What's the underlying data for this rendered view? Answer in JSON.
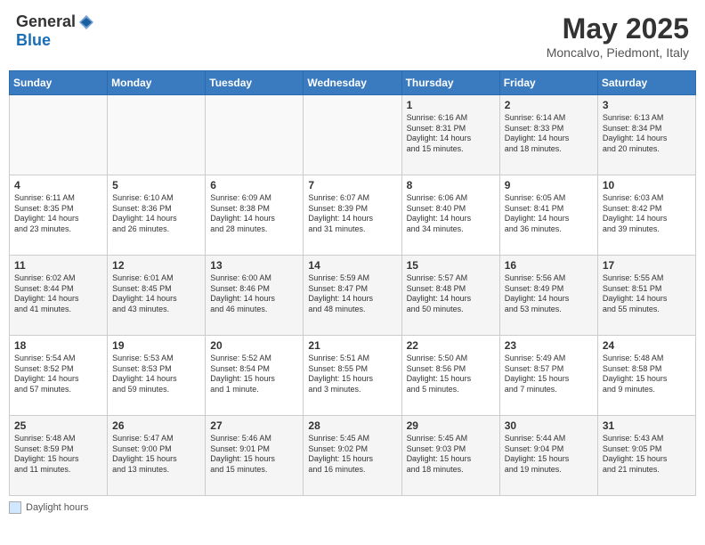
{
  "header": {
    "logo_general": "General",
    "logo_blue": "Blue",
    "month_title": "May 2025",
    "location": "Moncalvo, Piedmont, Italy"
  },
  "days_of_week": [
    "Sunday",
    "Monday",
    "Tuesday",
    "Wednesday",
    "Thursday",
    "Friday",
    "Saturday"
  ],
  "weeks": [
    [
      {
        "day": "",
        "info": ""
      },
      {
        "day": "",
        "info": ""
      },
      {
        "day": "",
        "info": ""
      },
      {
        "day": "",
        "info": ""
      },
      {
        "day": "1",
        "info": "Sunrise: 6:16 AM\nSunset: 8:31 PM\nDaylight: 14 hours\nand 15 minutes."
      },
      {
        "day": "2",
        "info": "Sunrise: 6:14 AM\nSunset: 8:33 PM\nDaylight: 14 hours\nand 18 minutes."
      },
      {
        "day": "3",
        "info": "Sunrise: 6:13 AM\nSunset: 8:34 PM\nDaylight: 14 hours\nand 20 minutes."
      }
    ],
    [
      {
        "day": "4",
        "info": "Sunrise: 6:11 AM\nSunset: 8:35 PM\nDaylight: 14 hours\nand 23 minutes."
      },
      {
        "day": "5",
        "info": "Sunrise: 6:10 AM\nSunset: 8:36 PM\nDaylight: 14 hours\nand 26 minutes."
      },
      {
        "day": "6",
        "info": "Sunrise: 6:09 AM\nSunset: 8:38 PM\nDaylight: 14 hours\nand 28 minutes."
      },
      {
        "day": "7",
        "info": "Sunrise: 6:07 AM\nSunset: 8:39 PM\nDaylight: 14 hours\nand 31 minutes."
      },
      {
        "day": "8",
        "info": "Sunrise: 6:06 AM\nSunset: 8:40 PM\nDaylight: 14 hours\nand 34 minutes."
      },
      {
        "day": "9",
        "info": "Sunrise: 6:05 AM\nSunset: 8:41 PM\nDaylight: 14 hours\nand 36 minutes."
      },
      {
        "day": "10",
        "info": "Sunrise: 6:03 AM\nSunset: 8:42 PM\nDaylight: 14 hours\nand 39 minutes."
      }
    ],
    [
      {
        "day": "11",
        "info": "Sunrise: 6:02 AM\nSunset: 8:44 PM\nDaylight: 14 hours\nand 41 minutes."
      },
      {
        "day": "12",
        "info": "Sunrise: 6:01 AM\nSunset: 8:45 PM\nDaylight: 14 hours\nand 43 minutes."
      },
      {
        "day": "13",
        "info": "Sunrise: 6:00 AM\nSunset: 8:46 PM\nDaylight: 14 hours\nand 46 minutes."
      },
      {
        "day": "14",
        "info": "Sunrise: 5:59 AM\nSunset: 8:47 PM\nDaylight: 14 hours\nand 48 minutes."
      },
      {
        "day": "15",
        "info": "Sunrise: 5:57 AM\nSunset: 8:48 PM\nDaylight: 14 hours\nand 50 minutes."
      },
      {
        "day": "16",
        "info": "Sunrise: 5:56 AM\nSunset: 8:49 PM\nDaylight: 14 hours\nand 53 minutes."
      },
      {
        "day": "17",
        "info": "Sunrise: 5:55 AM\nSunset: 8:51 PM\nDaylight: 14 hours\nand 55 minutes."
      }
    ],
    [
      {
        "day": "18",
        "info": "Sunrise: 5:54 AM\nSunset: 8:52 PM\nDaylight: 14 hours\nand 57 minutes."
      },
      {
        "day": "19",
        "info": "Sunrise: 5:53 AM\nSunset: 8:53 PM\nDaylight: 14 hours\nand 59 minutes."
      },
      {
        "day": "20",
        "info": "Sunrise: 5:52 AM\nSunset: 8:54 PM\nDaylight: 15 hours\nand 1 minute."
      },
      {
        "day": "21",
        "info": "Sunrise: 5:51 AM\nSunset: 8:55 PM\nDaylight: 15 hours\nand 3 minutes."
      },
      {
        "day": "22",
        "info": "Sunrise: 5:50 AM\nSunset: 8:56 PM\nDaylight: 15 hours\nand 5 minutes."
      },
      {
        "day": "23",
        "info": "Sunrise: 5:49 AM\nSunset: 8:57 PM\nDaylight: 15 hours\nand 7 minutes."
      },
      {
        "day": "24",
        "info": "Sunrise: 5:48 AM\nSunset: 8:58 PM\nDaylight: 15 hours\nand 9 minutes."
      }
    ],
    [
      {
        "day": "25",
        "info": "Sunrise: 5:48 AM\nSunset: 8:59 PM\nDaylight: 15 hours\nand 11 minutes."
      },
      {
        "day": "26",
        "info": "Sunrise: 5:47 AM\nSunset: 9:00 PM\nDaylight: 15 hours\nand 13 minutes."
      },
      {
        "day": "27",
        "info": "Sunrise: 5:46 AM\nSunset: 9:01 PM\nDaylight: 15 hours\nand 15 minutes."
      },
      {
        "day": "28",
        "info": "Sunrise: 5:45 AM\nSunset: 9:02 PM\nDaylight: 15 hours\nand 16 minutes."
      },
      {
        "day": "29",
        "info": "Sunrise: 5:45 AM\nSunset: 9:03 PM\nDaylight: 15 hours\nand 18 minutes."
      },
      {
        "day": "30",
        "info": "Sunrise: 5:44 AM\nSunset: 9:04 PM\nDaylight: 15 hours\nand 19 minutes."
      },
      {
        "day": "31",
        "info": "Sunrise: 5:43 AM\nSunset: 9:05 PM\nDaylight: 15 hours\nand 21 minutes."
      }
    ]
  ],
  "legend": {
    "box_label": "Daylight hours"
  }
}
